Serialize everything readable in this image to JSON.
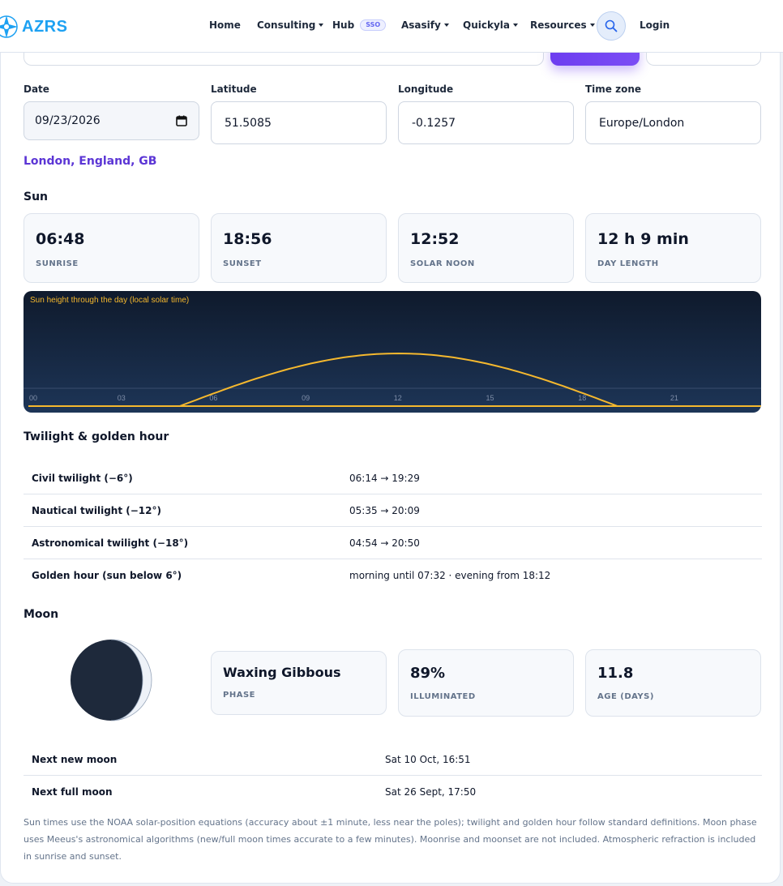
{
  "nav": {
    "brand": "AZRS",
    "items": [
      {
        "label": "Home",
        "dropdown": false
      },
      {
        "label": "Consulting",
        "dropdown": true
      },
      {
        "label": "Hub",
        "dropdown": false,
        "badge": "SSO"
      },
      {
        "label": "Asasify",
        "dropdown": true
      },
      {
        "label": "Quickyla",
        "dropdown": true
      },
      {
        "label": "Resources",
        "dropdown": true
      }
    ],
    "search_icon": "search-icon",
    "login": "Login"
  },
  "form": {
    "date_label": "Date",
    "date_value": "09/23/2026",
    "latitude_label": "Latitude",
    "latitude_value": "51.5085",
    "longitude_label": "Longitude",
    "longitude_value": "-0.1257",
    "timezone_label": "Time zone",
    "timezone_value": "Europe/London"
  },
  "place": "London, England, GB",
  "sun": {
    "title": "Sun",
    "stats": [
      {
        "value": "06:48",
        "caption": "SUNRISE"
      },
      {
        "value": "18:56",
        "caption": "SUNSET"
      },
      {
        "value": "12:52",
        "caption": "SOLAR NOON"
      },
      {
        "value": "12 h 9 min",
        "caption": "DAY LENGTH"
      }
    ]
  },
  "chart_data": {
    "type": "area",
    "title": "Sun height through the day (local solar time)",
    "x_ticks": [
      "00",
      "03",
      "06",
      "09",
      "12",
      "15",
      "18",
      "21"
    ],
    "x_range": [
      0,
      24
    ],
    "sunrise_hour": 6.0,
    "sunset_hour": 18.05,
    "peak_hour": 12,
    "line_color": "#f5b82e",
    "background_top": "#0f1a2c",
    "background_bottom": "#1d3557"
  },
  "twilight": {
    "title": "Twilight & golden hour",
    "rows": [
      {
        "label": "Civil twilight (−6°)",
        "value": "06:14 → 19:29"
      },
      {
        "label": "Nautical twilight (−12°)",
        "value": "05:35 → 20:09"
      },
      {
        "label": "Astronomical twilight (−18°)",
        "value": "04:54 → 20:50"
      },
      {
        "label": "Golden hour (sun below 6°)",
        "value": "morning until 07:32 · evening from 18:12"
      }
    ]
  },
  "moon": {
    "title": "Moon",
    "illumination_fraction": 0.89,
    "stats": [
      {
        "value": "Waxing Gibbous",
        "caption": "PHASE"
      },
      {
        "value": "89%",
        "caption": "ILLUMINATED"
      },
      {
        "value": "11.8",
        "caption": "AGE (DAYS)"
      }
    ],
    "rows": [
      {
        "label": "Next new moon",
        "value": "Sat 10 Oct, 16:51"
      },
      {
        "label": "Next full moon",
        "value": "Sat 26 Sept, 17:50"
      }
    ]
  },
  "footnote": "Sun times use the NOAA solar-position equations (accuracy about ±1 minute, less near the poles); twilight and golden hour follow standard definitions. Moon phase uses Meeus's astronomical algorithms (new/full moon times accurate to a few minutes). Moonrise and moonset are not included. Atmospheric refraction is included in sunrise and sunset."
}
